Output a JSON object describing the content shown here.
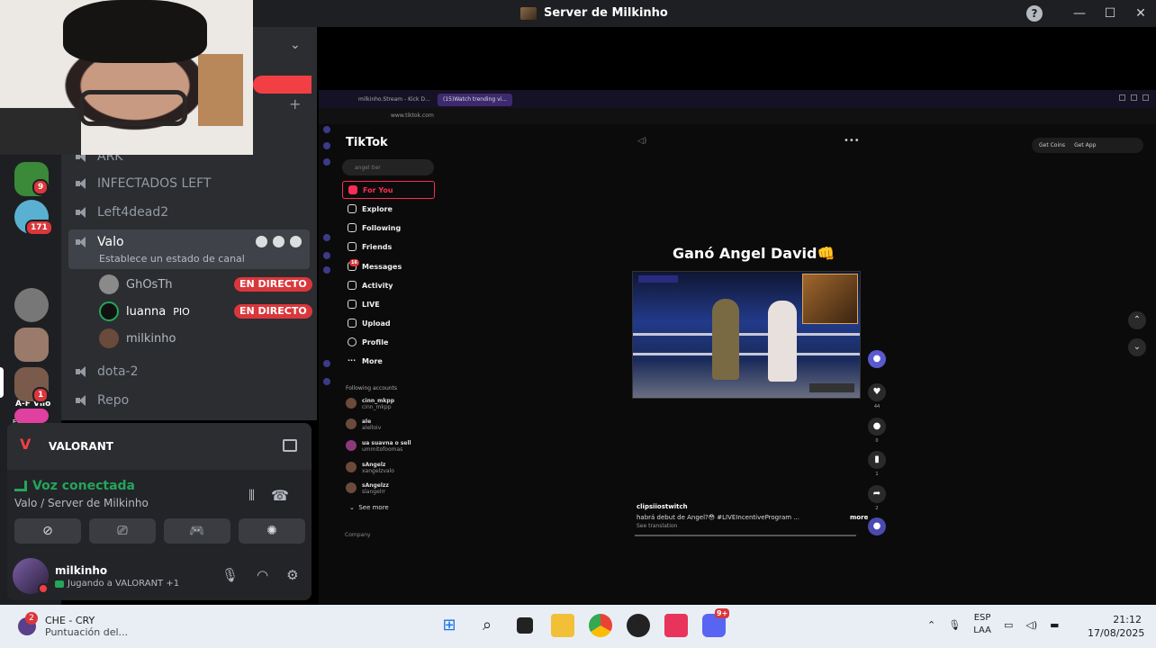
{
  "window": {
    "title": "Server de Milkinho",
    "help": "?",
    "minimize": "—",
    "maximize": "☐",
    "close": "✕"
  },
  "servers": {
    "badges": [
      "9",
      "171",
      "1"
    ],
    "label": "A-F Vllo",
    "sublabel": "Estl."
  },
  "channels": {
    "items": [
      "ARK",
      "INFECTADOS LEFT",
      "Left4dead2",
      "Valo",
      "dota-2",
      "Repo"
    ],
    "active_status": "Establece un estado de canal",
    "voice_users": [
      {
        "name": "GhOsTh",
        "live": "EN DIRECTO"
      },
      {
        "name": "luanna",
        "tag": "PIO",
        "live": "EN DIRECTO"
      },
      {
        "name": "milkinho",
        "live": ""
      }
    ]
  },
  "game": {
    "name": "VALORANT"
  },
  "voice": {
    "status": "Voz conectada",
    "location": "Valo / Server de Milkinho"
  },
  "user": {
    "name": "milkinho",
    "activity": "Jugando a VALORANT +1"
  },
  "browser": {
    "tabs": [
      "milkinho.Stream - Kick D...",
      "(15)Watch trending vi..."
    ],
    "url": "www.tiktok.com",
    "tiktok": {
      "logo": "TikTok",
      "search_placeholder": "angel tier",
      "nav": [
        "For You",
        "Explore",
        "Following",
        "Friends",
        "Messages",
        "Activity",
        "LIVE",
        "Upload",
        "Profile",
        "More"
      ],
      "messages_badge": "16",
      "following_title": "Following accounts",
      "accounts": [
        {
          "name": "cinn_mkpp",
          "handle": "cinn_mkpp"
        },
        {
          "name": "ale",
          "handle": "alelloiv"
        },
        {
          "name": "ua suavna o sell",
          "handle": "ummitofoomas"
        },
        {
          "name": "sAngelz",
          "handle": "xangelzvalo"
        },
        {
          "name": "sAngelzz",
          "handle": "slangelrr"
        }
      ],
      "see_more": "See more",
      "company": "Company",
      "get_coins": "Get Coins",
      "get_app": "Get App",
      "video_title": "Ganó Angel David👊",
      "author": "clipsiiostwitch",
      "caption": "habrá debut de Angel?😳 #LIVEIncentiveProgram ...",
      "more": "more",
      "see_translation": "See translation",
      "counts": [
        "44",
        "0",
        "1",
        "2"
      ]
    }
  },
  "taskbar": {
    "notif_count": "2",
    "song": "CHE - CRY",
    "song_sub": "Puntuación del...",
    "discord_badge": "9+",
    "lang1": "ESP",
    "lang2": "LAA",
    "time": "21:12",
    "date": "17/08/2025"
  }
}
